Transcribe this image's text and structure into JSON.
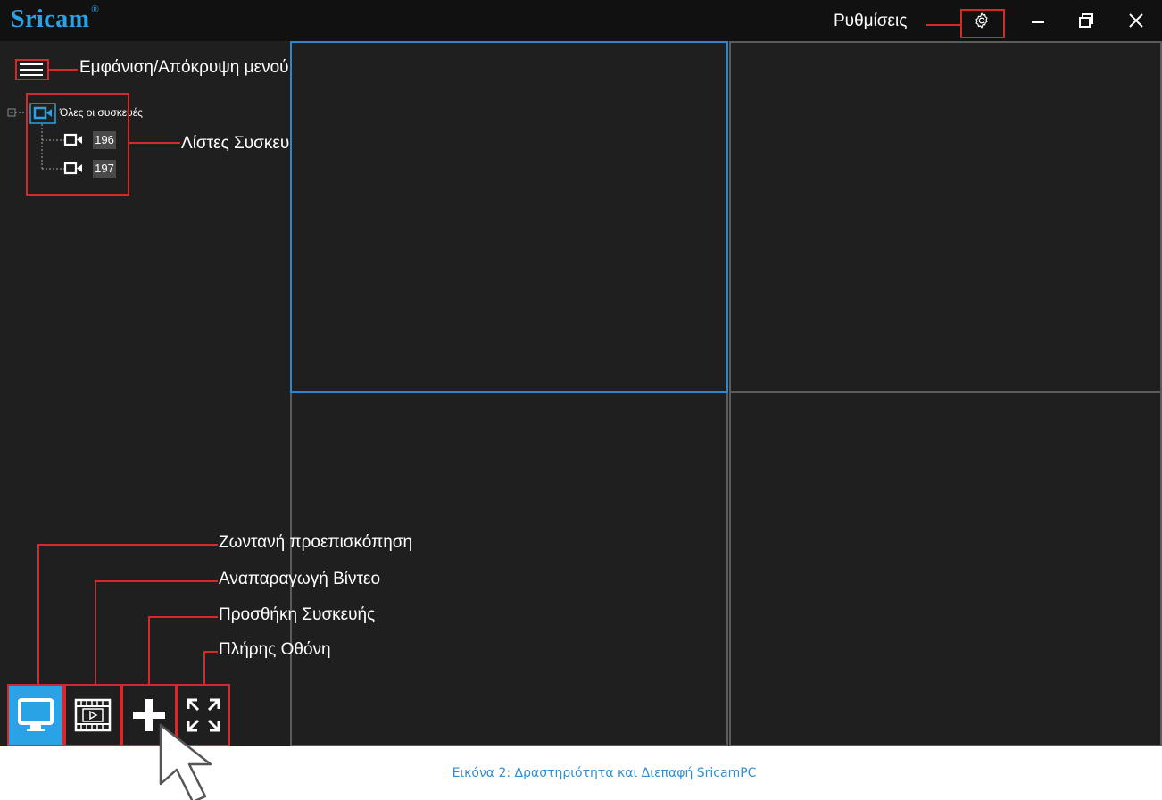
{
  "titlebar": {
    "logo": "Sricam",
    "logo_mark": "®",
    "settings_label": "Ρυθμίσεις",
    "settings_icon": "gear-icon",
    "minimize_icon": "minimize-icon",
    "restore_icon": "restore-icon",
    "close_icon": "close-icon"
  },
  "sidebar": {
    "menu_toggle_label": "Εμφάνιση/Απόκρυψη μενού",
    "tree": {
      "root_label": "Όλες οι συσκευές",
      "devices": [
        {
          "id": "196"
        },
        {
          "id": "197"
        }
      ]
    },
    "device_list_label": "Λίστες Συσκευών"
  },
  "toolbar": {
    "live_preview_label": "Ζωντανή προεπισκόπηση",
    "playback_label": "Αναπαραγωγή Βίντεο",
    "add_device_label": "Προσθήκη Συσκευής",
    "fullscreen_label": "Πλήρης Οθόνη"
  },
  "caption": "Εικόνα 2: Δραστηριότητα και Διεπαφή SricamPC",
  "colors": {
    "accent": "#2aa3e6",
    "annotation": "#d42a2a",
    "background": "#1f1f1f",
    "titlebar": "#111111"
  }
}
